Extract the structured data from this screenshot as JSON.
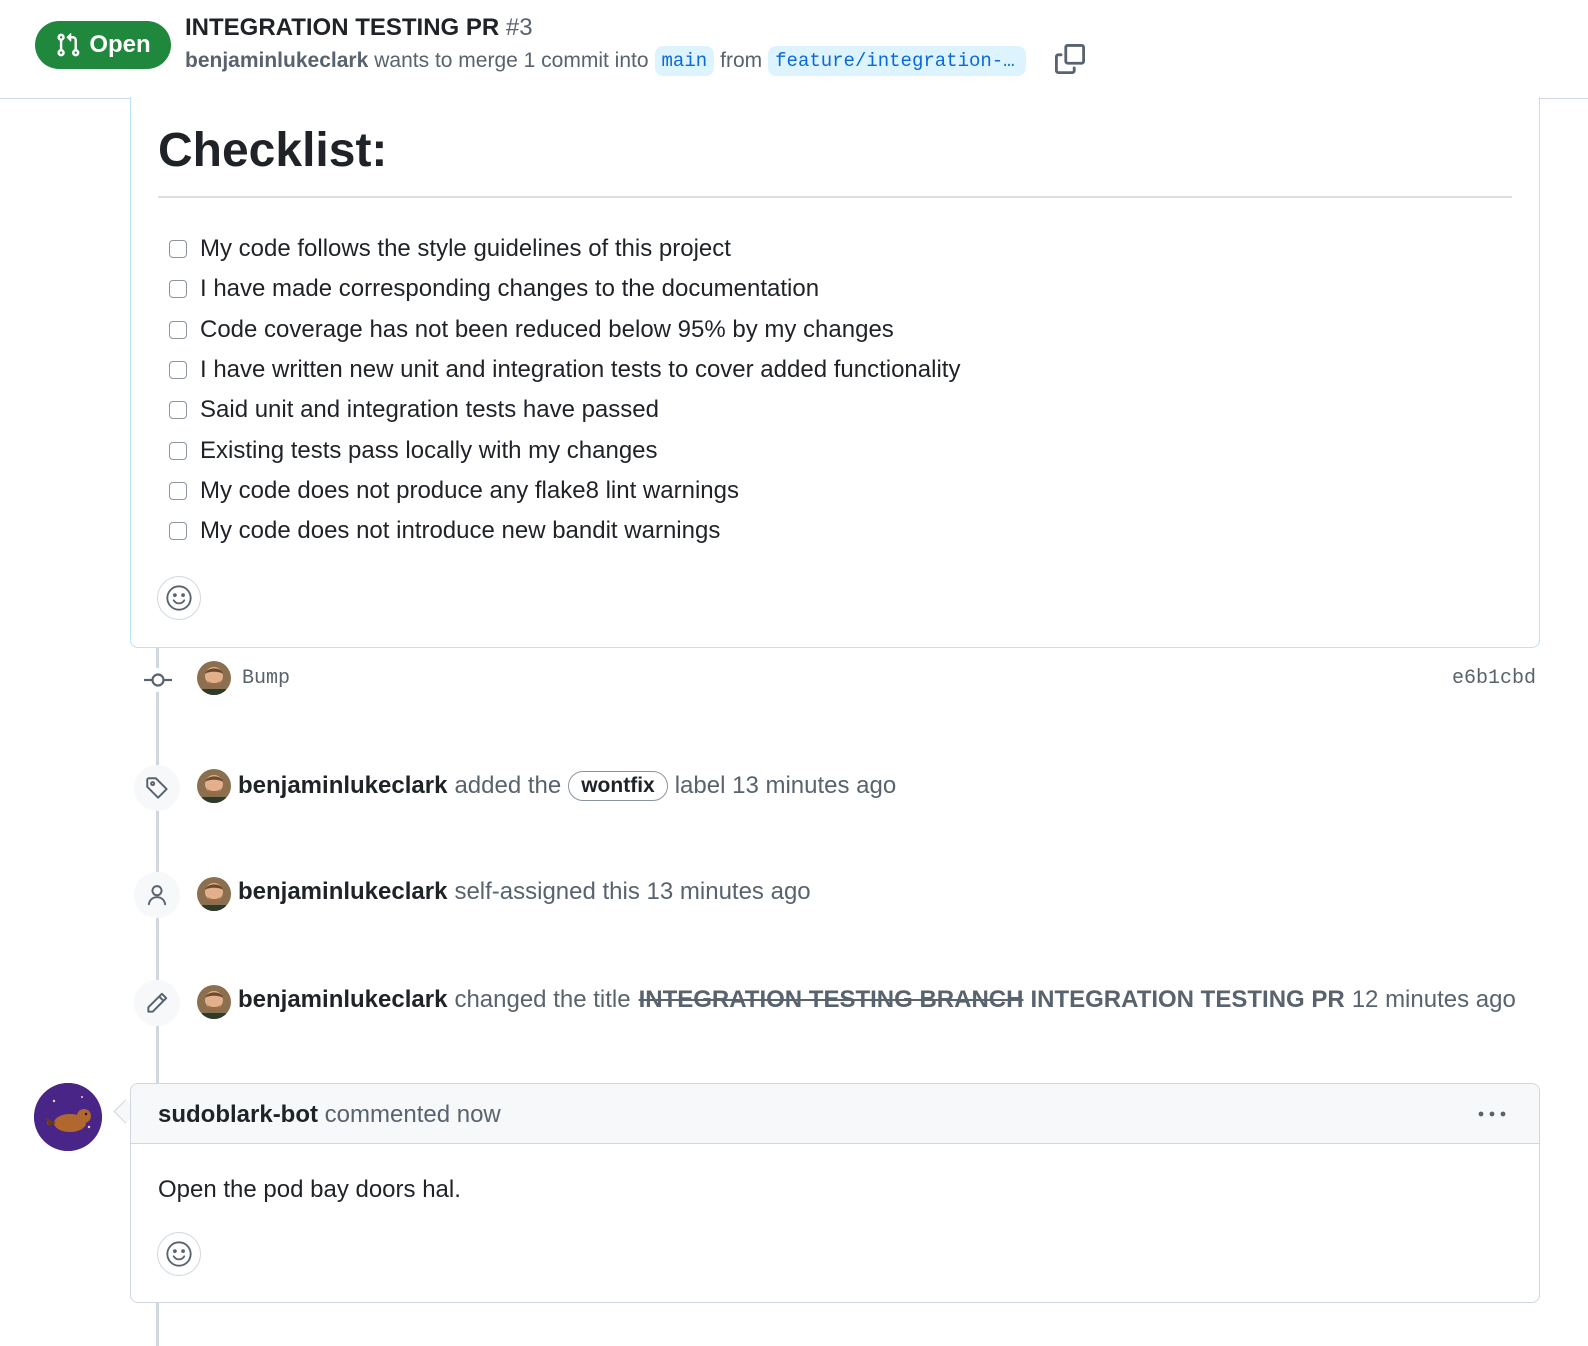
{
  "header": {
    "state": "Open",
    "title": "INTEGRATION TESTING PR",
    "number": "#3",
    "author": "benjaminlukeclark",
    "merge_text": "wants to merge 1 commit into",
    "base_branch": "main",
    "from_text": "from",
    "head_branch": "feature/integration-t…"
  },
  "description": {
    "heading": "Checklist:",
    "tasks": [
      "My code follows the style guidelines of this project",
      "I have made corresponding changes to the documentation",
      "Code coverage has not been reduced below 95% by my changes",
      "I have written new unit and integration tests to cover added functionality",
      "Said unit and integration tests have passed",
      "Existing tests pass locally with my changes",
      "My code does not produce any flake8 lint warnings",
      "My code does not introduce new bandit warnings"
    ]
  },
  "commit": {
    "message": "Bump",
    "sha": "e6b1cbd"
  },
  "events": {
    "label": {
      "actor": "benjaminlukeclark",
      "pre": "added the",
      "label": "wontfix",
      "post": "label 13 minutes ago"
    },
    "assign": {
      "actor": "benjaminlukeclark",
      "text": "self-assigned this 13 minutes ago"
    },
    "rename": {
      "actor": "benjaminlukeclark",
      "pre": "changed the title",
      "old_title": "INTEGRATION TESTING BRANCH",
      "new_title": "INTEGRATION TESTING PR",
      "post": "12 minutes ago"
    }
  },
  "bot_comment": {
    "author": "sudoblark-bot",
    "action": "commented now",
    "body": "Open the pod bay doors hal."
  },
  "colors": {
    "open_green": "#1f883d",
    "link_blue": "#0969da",
    "branch_bg": "#ddf4ff"
  },
  "icons": [
    "git-pull-request-icon",
    "copy-icon",
    "smiley-icon",
    "git-commit-icon",
    "tag-icon",
    "person-icon",
    "pencil-icon",
    "kebab-horizontal-icon"
  ]
}
